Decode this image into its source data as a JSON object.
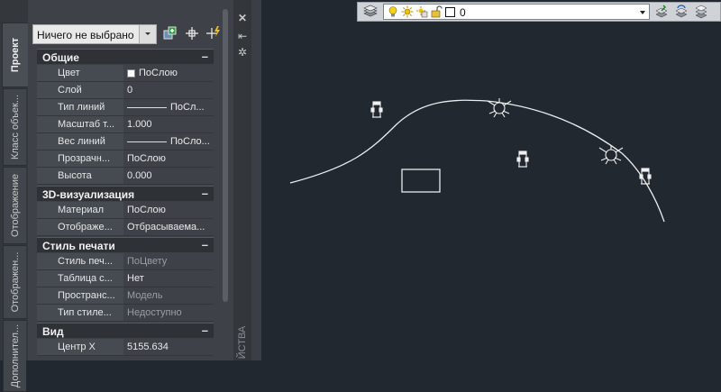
{
  "palette": {
    "tabs": [
      "Проект",
      "Класс объек...",
      "Отображение",
      "Отображен...",
      "Дополнител..."
    ],
    "selector_value": "Ничего не выбрано",
    "side_strip_label": "ЙСТВА",
    "sections": [
      {
        "title": "Общие",
        "rows": [
          {
            "key": "Цвет",
            "value": "ПоСлою",
            "swatch": "square"
          },
          {
            "key": "Слой",
            "value": "0"
          },
          {
            "key": "Тип линий",
            "value": "ПоСл...",
            "swatch": "line"
          },
          {
            "key": "Масштаб т...",
            "value": "1.000"
          },
          {
            "key": "Вес линий",
            "value": "ПоСло...",
            "swatch": "line"
          },
          {
            "key": "Прозрачн...",
            "value": "ПоСлою"
          },
          {
            "key": "Высота",
            "value": "0.000"
          }
        ]
      },
      {
        "title": "3D-визуализация",
        "rows": [
          {
            "key": "Материал",
            "value": "ПоСлою"
          },
          {
            "key": "Отображе...",
            "value": "Отбрасываема..."
          }
        ]
      },
      {
        "title": "Стиль печати",
        "rows": [
          {
            "key": "Стиль печ...",
            "value": "ПоЦвету",
            "dim": true
          },
          {
            "key": "Таблица с...",
            "value": "Нет"
          },
          {
            "key": "Пространс...",
            "value": "Модель",
            "dim": true
          },
          {
            "key": "Тип стиле...",
            "value": "Недоступно",
            "dim": true
          }
        ]
      },
      {
        "title": "Вид",
        "rows": [
          {
            "key": "Центр X",
            "value": "5155.634"
          }
        ]
      }
    ]
  },
  "layer_toolbar": {
    "current_layer": "0"
  }
}
